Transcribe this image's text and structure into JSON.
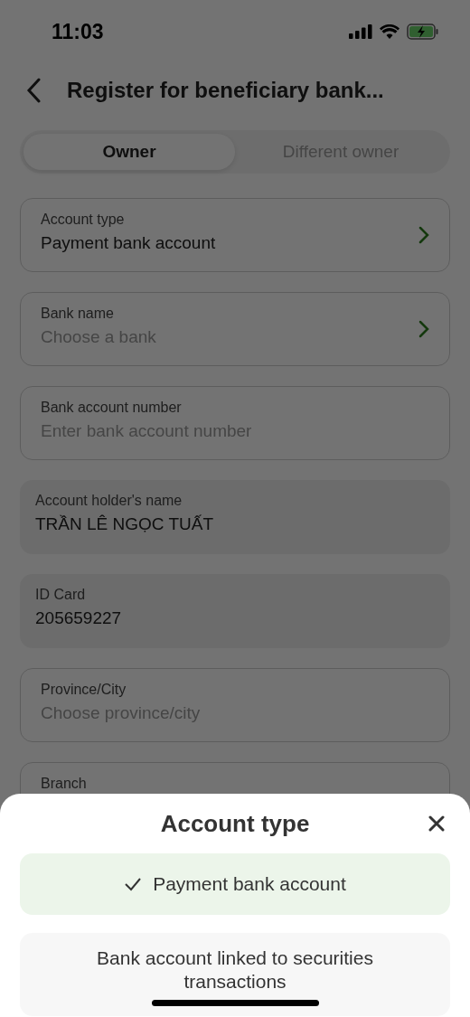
{
  "status_bar": {
    "time": "11:03"
  },
  "header": {
    "title": "Register for beneficiary bank..."
  },
  "tabs": [
    {
      "label": "Owner",
      "selected": true
    },
    {
      "label": "Different owner",
      "selected": false
    }
  ],
  "fields": [
    {
      "kind": "select",
      "label": "Account type",
      "value": "Payment bank account"
    },
    {
      "kind": "select",
      "label": "Bank name",
      "placeholder": "Choose a bank"
    },
    {
      "kind": "input",
      "label": "Bank account number",
      "placeholder": "Enter bank account number"
    },
    {
      "kind": "readonly",
      "label": "Account holder's name",
      "value": "TRẦN LÊ NGỌC TUẤT"
    },
    {
      "kind": "readonly",
      "label": "ID Card",
      "value": "205659227"
    },
    {
      "kind": "input",
      "label": "Province/City",
      "placeholder": "Choose province/city"
    },
    {
      "kind": "input",
      "label": "Branch"
    }
  ],
  "sheet": {
    "title": "Account type",
    "options": [
      {
        "label": "Payment bank account",
        "selected": true
      },
      {
        "label": "Bank account linked to securities transactions",
        "selected": false
      }
    ]
  }
}
